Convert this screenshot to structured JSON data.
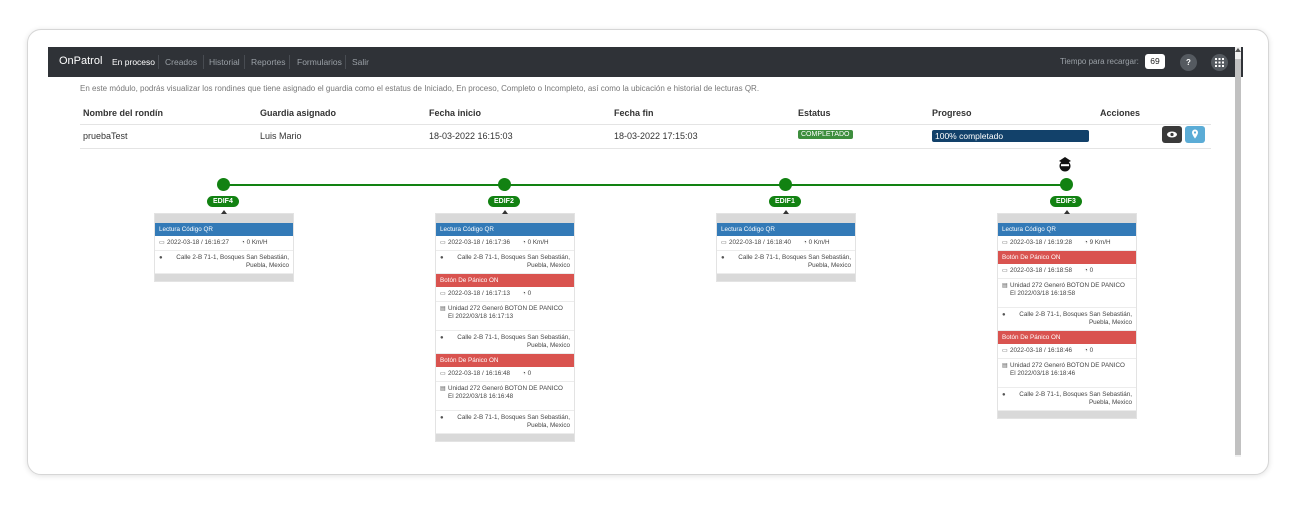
{
  "navbar": {
    "brand": "OnPatrol",
    "items": [
      "En proceso",
      "Creados",
      "Historial",
      "Reportes",
      "Formularios",
      "Salir"
    ],
    "reload_label": "Tiempo para recargar:",
    "reload_value": "69",
    "help_icon": "?",
    "apps_icon": "grid-icon"
  },
  "info_text": "En este módulo, podrás visualizar los rondines que tiene asignado el guardia como el estatus de Iniciado, En proceso, Completo o Incompleto, así como la ubicación e historial de lecturas QR.",
  "table": {
    "headers": [
      "Nombre del rondín",
      "Guardia asignado",
      "Fecha inicio",
      "Fecha fin",
      "Estatus",
      "Progreso",
      "Acciones"
    ],
    "row": {
      "name": "pruebaTest",
      "guard": "Luis Mario",
      "start": "18-03-2022 16:15:03",
      "end": "18-03-2022 17:15:03",
      "status": "COMPLETADO",
      "progress": "100% completado",
      "progress_value": 1.0
    }
  },
  "timeline": [
    {
      "label": "EDIF4",
      "events": [
        {
          "type": "Lectura Código QR",
          "color": "blue",
          "date": "2022-03-18 / 16:16:27",
          "speed": "0 Km/H",
          "address": "Calle 2-B 71-1, Bosques San Sebastián, Puebla, Mexico"
        }
      ]
    },
    {
      "label": "EDIF2",
      "events": [
        {
          "type": "Lectura Código QR",
          "color": "blue",
          "date": "2022-03-18 / 16:17:36",
          "speed": "0 Km/H",
          "address": "Calle 2-B 71-1, Bosques San Sebastián, Puebla, Mexico"
        },
        {
          "type": "Botón De Pánico ON",
          "color": "red",
          "date": "2022-03-18 / 16:17:13",
          "speed": "0",
          "detail": "Unidad 272 Generó BOTON DE PANICO El 2022/03/18 16:17:13",
          "address": "Calle 2-B 71-1, Bosques San Sebastián, Puebla, Mexico"
        },
        {
          "type": "Botón De Pánico ON",
          "color": "red",
          "date": "2022-03-18 / 16:16:48",
          "speed": "0",
          "detail": "Unidad 272 Generó BOTON DE PANICO El 2022/03/18 16:16:48",
          "address": "Calle 2-B 71-1, Bosques San Sebastián, Puebla, Mexico"
        }
      ]
    },
    {
      "label": "EDIF1",
      "events": [
        {
          "type": "Lectura Código QR",
          "color": "blue",
          "date": "2022-03-18 / 16:18:40",
          "speed": "0 Km/H",
          "address": "Calle 2-B 71-1, Bosques San Sebastián, Puebla, Mexico"
        }
      ]
    },
    {
      "label": "EDIF3",
      "events": [
        {
          "type": "Lectura Código QR",
          "color": "blue",
          "date": "2022-03-18 / 16:19:28",
          "speed": "9 Km/H"
        },
        {
          "type": "Botón De Pánico ON",
          "color": "red",
          "date": "2022-03-18 / 16:18:58",
          "speed": "0",
          "detail": "Unidad 272 Generó BOTON DE PANICO El 2022/03/18 16:18:58",
          "address": "Calle 2-B 71-1, Bosques San Sebastián, Puebla, Mexico"
        },
        {
          "type": "Botón De Pánico ON",
          "color": "red",
          "date": "2022-03-18 / 16:18:46",
          "speed": "0",
          "detail": "Unidad 272 Generó BOTON DE PANICO El 2022/03/18 16:18:46",
          "address": "Calle 2-B 71-1, Bosques San Sebastián, Puebla, Mexico"
        }
      ]
    }
  ],
  "colors": {
    "navbar": "#2f3237",
    "success": "#128212",
    "qr": "#337ab7",
    "panic": "#d9534f",
    "progress": "#12416a"
  }
}
